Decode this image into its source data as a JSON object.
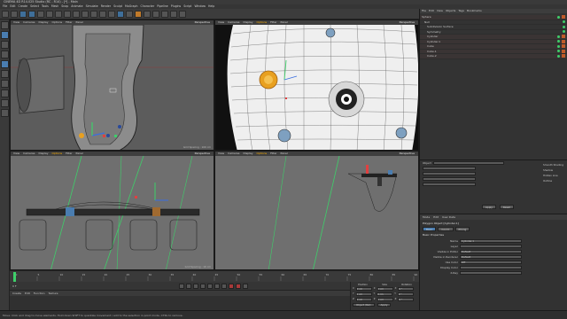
{
  "app": {
    "title": "CINEMA 4D R14.025 Studio (RC - R14) - [*] - Main",
    "menu": [
      "File",
      "Edit",
      "Create",
      "Select",
      "Tools",
      "Mesh",
      "Snap",
      "Animate",
      "Simulate",
      "Render",
      "Sculpt",
      "MoGraph",
      "Character",
      "Pipeline",
      "Plugins",
      "Script",
      "Window",
      "Help"
    ],
    "layout_label": "Layout: Startup"
  },
  "viewports": {
    "top_left": {
      "menu": [
        "View",
        "Cameras",
        "Display",
        "Options",
        "Filter",
        "Panel"
      ],
      "name": "Perspective",
      "grid": "Grid Spacing : 100 cm"
    },
    "top_right": {
      "menu": [
        "View",
        "Cameras",
        "Display",
        "Options",
        "Filter",
        "Panel"
      ],
      "name": "Perspective",
      "grid": ""
    },
    "bottom_left": {
      "menu": [
        "View",
        "Cameras",
        "Display",
        "Options",
        "Filter",
        "Panel"
      ],
      "name": "Perspective",
      "grid": "Grid Spacing : 10 cm"
    },
    "bottom_right": {
      "menu": [
        "View",
        "Cameras",
        "Display",
        "Options",
        "Filter",
        "Panel"
      ],
      "name": "Perspective",
      "grid": ""
    }
  },
  "object_manager": {
    "tabs": [
      "File",
      "Edit",
      "View",
      "Objects",
      "Tags",
      "Bookmarks"
    ],
    "objects": [
      {
        "label": "Sphere",
        "tag": true
      },
      {
        "label": "Null",
        "tag": false
      },
      {
        "label": "Subdivision Surface",
        "tag": false
      },
      {
        "label": "Symmetry",
        "tag": false
      },
      {
        "label": "Cylinder",
        "tag": true
      },
      {
        "label": "Cylinder.1",
        "tag": true
      },
      {
        "label": "Cube",
        "tag": true
      },
      {
        "label": "Cube.1",
        "tag": true
      },
      {
        "label": "Cube.2",
        "tag": true
      }
    ],
    "highlight_color": "#c05a2a"
  },
  "attribute_manager": {
    "mode_label": "Mode",
    "edit_label": "Edit",
    "user_data_label": "User Data",
    "object_title": "Polygon Object [Cylinder.1]",
    "tabs": [
      "Basic",
      "Coord.",
      "Phong"
    ],
    "section": "Basic Properties",
    "fields": [
      {
        "label": "Name",
        "value": "Cylinder.1"
      },
      {
        "label": "Layer",
        "value": ""
      },
      {
        "label": "Visible in Editor",
        "value": "Default"
      },
      {
        "label": "Visible in Renderer",
        "value": "Default"
      },
      {
        "label": "Use Color",
        "value": "Off"
      },
      {
        "label": "Display Color",
        "value": ""
      },
      {
        "label": "X-Ray",
        "value": ""
      }
    ],
    "upper": {
      "type_label": "Object",
      "options": [
        "Smooth Shading",
        "Shadow",
        "Hidden Line",
        "Outline"
      ],
      "buttons": [
        "Apply",
        "Reset"
      ]
    }
  },
  "timeline": {
    "ticks": [
      "0",
      "5",
      "10",
      "15",
      "20",
      "25",
      "30",
      "35",
      "40",
      "45",
      "50",
      "55",
      "60",
      "65",
      "70",
      "75",
      "80",
      "85",
      "90"
    ],
    "current": "0 F",
    "end": "90 F"
  },
  "material_manager": {
    "tabs": [
      "Create",
      "Edit",
      "Function",
      "Texture"
    ]
  },
  "coordinates": {
    "headers": [
      "Position",
      "Size",
      "Rotation"
    ],
    "rows": [
      {
        "axis": "X",
        "pos": "0 cm",
        "size": "0 cm",
        "rot": "0 °"
      },
      {
        "axis": "Y",
        "pos": "0 cm",
        "size": "0 cm",
        "rot": "0 °"
      },
      {
        "axis": "Z",
        "pos": "0 cm",
        "size": "0 cm",
        "rot": "0 °"
      }
    ],
    "mode": "Object (Rel)",
    "apply": "Apply"
  },
  "status": {
    "text": "Move: Click and drag to move elements. Hold down SHIFT to quantize movement / add to the selection in point mode, CTRL to remove."
  },
  "colors": {
    "accent": "#ffb000",
    "axis_green": "#3ecf6a",
    "axis_red": "#e04040",
    "axis_blue": "#3a6ee0"
  }
}
